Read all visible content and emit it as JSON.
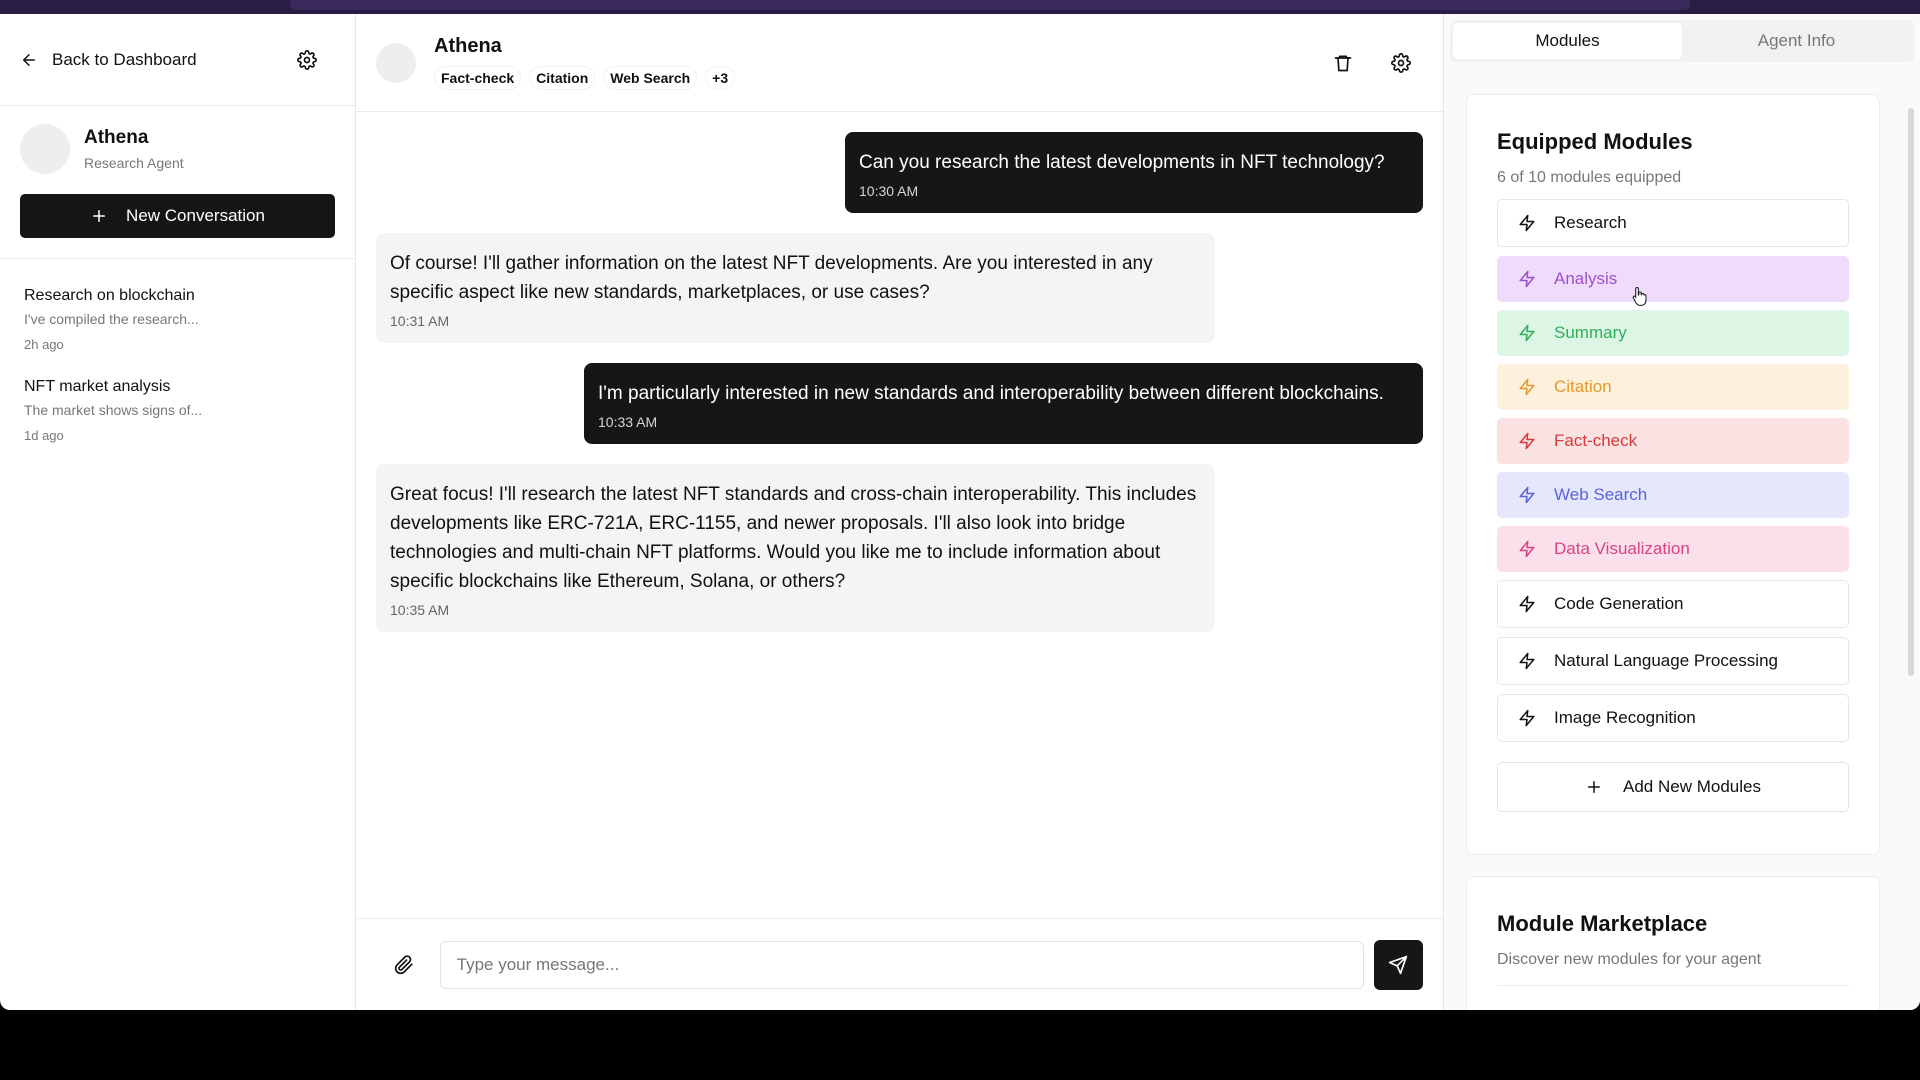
{
  "sidebar": {
    "back_label": "Back to Dashboard",
    "agent": {
      "name": "Athena",
      "role": "Research Agent"
    },
    "new_conversation_label": "New Conversation",
    "conversations": [
      {
        "title": "Research on blockchain",
        "snippet": "I've compiled the research...",
        "time": "2h ago"
      },
      {
        "title": "NFT market analysis",
        "snippet": "The market shows signs of...",
        "time": "1d ago"
      }
    ]
  },
  "chat": {
    "agent_name": "Athena",
    "tags": [
      "Fact-check",
      "Citation",
      "Web Search",
      "+3"
    ],
    "messages": [
      {
        "role": "user",
        "text": "Can you research the latest developments in NFT technology?",
        "time": "10:30 AM"
      },
      {
        "role": "bot",
        "text": "Of course! I'll gather information on the latest NFT developments. Are you interested in any specific aspect like new standards, marketplaces, or use cases?",
        "time": "10:31 AM"
      },
      {
        "role": "user",
        "text": "I'm particularly interested in new standards and interoperability between different blockchains.",
        "time": "10:33 AM"
      },
      {
        "role": "bot",
        "text": "Great focus! I'll research the latest NFT standards and cross-chain interoperability. This includes developments like ERC-721A, ERC-1155, and newer proposals. I'll also look into bridge technologies and multi-chain NFT platforms. Would you like me to include information about specific blockchains like Ethereum, Solana, or others?",
        "time": "10:35 AM"
      }
    ],
    "input_placeholder": "Type your message..."
  },
  "panel": {
    "tabs": [
      "Modules",
      "Agent Info"
    ],
    "active_tab": "Modules",
    "equipped": {
      "title": "Equipped Modules",
      "subtitle": "6 of 10 modules equipped",
      "modules": [
        {
          "label": "Research",
          "style": "plain",
          "bg": "#ffffff",
          "color": "#111111",
          "border": "#e6e6e6"
        },
        {
          "label": "Analysis",
          "style": "tinted",
          "bg": "#efdcfb",
          "color": "#a04fd0",
          "border": "#efdcfb"
        },
        {
          "label": "Summary",
          "style": "tinted",
          "bg": "#ddf5e4",
          "color": "#2fae5a",
          "border": "#ddf5e4"
        },
        {
          "label": "Citation",
          "style": "tinted",
          "bg": "#fdf0dd",
          "color": "#e29a2e",
          "border": "#fdf0dd"
        },
        {
          "label": "Fact-check",
          "style": "tinted",
          "bg": "#fbe2e2",
          "color": "#d63b3b",
          "border": "#fbe2e2"
        },
        {
          "label": "Web Search",
          "style": "tinted",
          "bg": "#e5e8fc",
          "color": "#5b63d8",
          "border": "#e5e8fc"
        },
        {
          "label": "Data Visualization",
          "style": "tinted",
          "bg": "#fbe0ec",
          "color": "#d9447f",
          "border": "#fbe0ec"
        },
        {
          "label": "Code Generation",
          "style": "plain",
          "bg": "#ffffff",
          "color": "#111111",
          "border": "#e6e6e6"
        },
        {
          "label": "Natural Language Processing",
          "style": "plain",
          "bg": "#ffffff",
          "color": "#111111",
          "border": "#e6e6e6"
        },
        {
          "label": "Image Recognition",
          "style": "plain",
          "bg": "#ffffff",
          "color": "#111111",
          "border": "#e6e6e6"
        }
      ],
      "add_label": "Add New Modules"
    },
    "marketplace": {
      "title": "Module Marketplace",
      "subtitle": "Discover new modules for your agent"
    }
  }
}
